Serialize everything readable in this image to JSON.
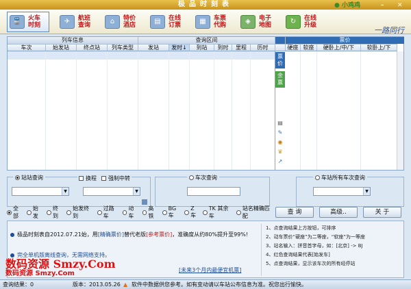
{
  "app": {
    "title": "极品时刻表",
    "user": "小鸡鸡"
  },
  "toolbar": [
    {
      "label": "火车时刻",
      "icon": "train-icon",
      "active": true
    },
    {
      "label": "航班查询",
      "icon": "plane-icon",
      "active": false
    },
    {
      "label": "特价酒店",
      "icon": "hotel-icon",
      "active": false
    },
    {
      "label": "在线订票",
      "icon": "ticket-icon",
      "active": false
    },
    {
      "label": "车票代购",
      "icon": "cart-icon",
      "active": false
    },
    {
      "label": "电子地图",
      "icon": "map-icon",
      "active": false
    },
    {
      "label": "在线升级",
      "icon": "upgrade-icon",
      "active": false
    }
  ],
  "signature": "一路同行",
  "table": {
    "group_train": "列车信息",
    "group_query": "查询区间",
    "group_price": "票价",
    "cols": [
      "车次",
      "始发站",
      "终点站",
      "列车类型",
      "发站",
      "发时↓",
      "到站",
      "到时",
      "里程",
      "历时",
      "硬座",
      "软座",
      "硬卧上/中/下",
      "软卧上/下"
    ],
    "price_tab": "票价",
    "remain_tab": "余票"
  },
  "filters": {
    "station_query": "站站查询",
    "transfer": "换程",
    "force_transfer": "强制中转",
    "train_query": "车次查询",
    "station_all": "车站所有车次查询"
  },
  "options": [
    "全部",
    "始发",
    "终到",
    "始发终到",
    "过路车",
    "动车",
    "高铁",
    "BG车",
    "Z车",
    "TK 其余车",
    "站名精确匹配"
  ],
  "buttons": {
    "query": "查 询",
    "advanced": "高级..",
    "about": "关 于"
  },
  "info": {
    "line1_pre": "极品时刻表自2012.07.21始，用",
    "line1_a": "[精确票价]",
    "line1_mid": "替代老版",
    "line1_b": "[参考票价]",
    "line1_post": "，准确度从约80%提升至99%!",
    "line2": "完全单机版离线查询，无需网络支持。",
    "link": "[未来3个月内最便宜机票]",
    "tips": [
      "1、点查询结果上方按钮，可排序",
      "2、动车票价“硬座”为二等座，“软座”为一等座",
      "3、站名输入：拼音首字母，如：[北京] -> BJ",
      "4、红色查询结果代表[始发车]",
      "5、点查询结果，显示该车次的所有经停站"
    ]
  },
  "watermark": {
    "line1": "数码资源  Smzy.Com",
    "line2": "数码资源 Smzy.Com"
  },
  "status": {
    "result": "查询结果：0",
    "version": "版本：2013.05.26",
    "notice": "软件中数据供您参考。如有变动请以车站公布信息为准。祝您出行愉快。"
  }
}
